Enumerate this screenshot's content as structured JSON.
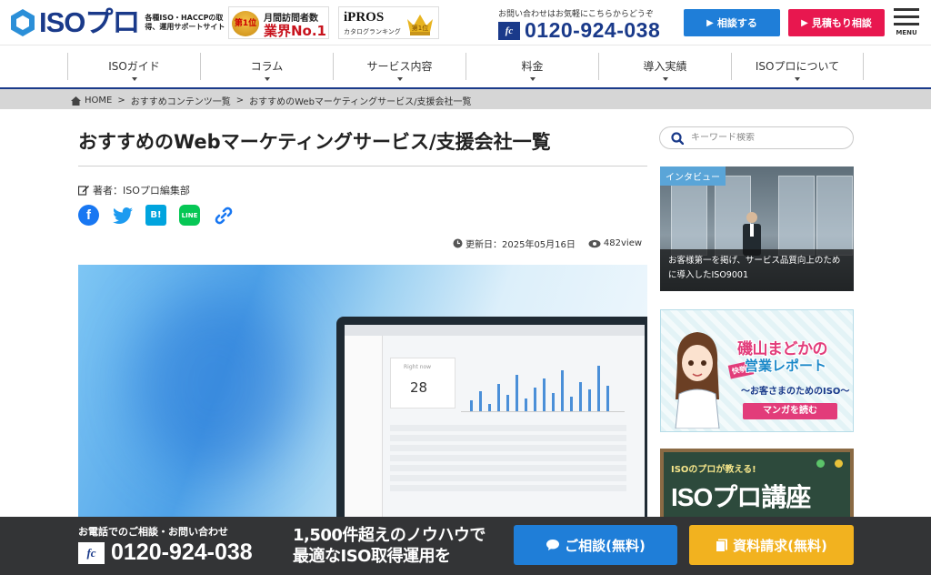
{
  "header": {
    "logo_text": "ISOプロ",
    "logo_sub": "各種ISO・HACCPの取得、運用サポートサイト",
    "badge_rank": {
      "rank": "第1位",
      "line1": "月間訪問者数",
      "line2": "業界No.1"
    },
    "badge_ipros": {
      "brand": "iPROS",
      "sub": "カタログランキング",
      "rank": "第1位"
    },
    "contact_note": "お問い合わせはお気軽にこちらからどうぞ",
    "phone_brand": "fc",
    "phone": "0120-924-038",
    "consult_label": "相談する",
    "estimate_label": "見積もり相談",
    "menu_label": "MENU"
  },
  "nav": {
    "items": [
      "ISOガイド",
      "コラム",
      "サービス内容",
      "料金",
      "導入実績",
      "ISOプロについて"
    ]
  },
  "breadcrumb": {
    "home": "HOME",
    "sep": ">",
    "level1": "おすすめコンテンツ一覧",
    "level2": "おすすめのWebマーケティングサービス/支援会社一覧"
  },
  "article": {
    "title": "おすすめのWebマーケティングサービス/支援会社一覧",
    "author": "著者：ISOプロ編集部",
    "share": {
      "facebook": "f",
      "twitter": "🐦",
      "hatena": "B!",
      "line": "LINE",
      "link": "🔗"
    },
    "updated": "更新日：2025年05月16日",
    "views": "482view",
    "hero_screen": {
      "card_label": "Right now",
      "card_value": "28"
    }
  },
  "sidebar": {
    "search_placeholder": "キーワード検索",
    "interview": {
      "tag": "インタビュー",
      "caption": "お客様第一を掲げ、サービス品質向上のために導入したISO9001"
    },
    "manga": {
      "title": "磯山まどかの",
      "subtitle": "営業レポート",
      "stamp": "快挙!",
      "tagline": "〜お客さまのためのISO〜",
      "cta": "マンガを読む"
    },
    "course": {
      "lead": "ISOのプロが教える!",
      "title": "ISOプロ講座"
    }
  },
  "cta_bar": {
    "note": "お電話でのご相談・お問い合わせ",
    "phone_brand": "fc",
    "phone": "0120-924-038",
    "message_line1": "1,500件超えのノウハウで",
    "message_line2": "最適なISO取得運用を",
    "consult_button": "ご相談(無料)",
    "materials_button": "資料請求(無料)"
  },
  "colors": {
    "brand": "#1a3a8a",
    "consult_blue": "#1f7ed8",
    "estimate_pink": "#e8174f",
    "materials_orange": "#f2b21f",
    "cta_bar_bg": "#333436"
  }
}
